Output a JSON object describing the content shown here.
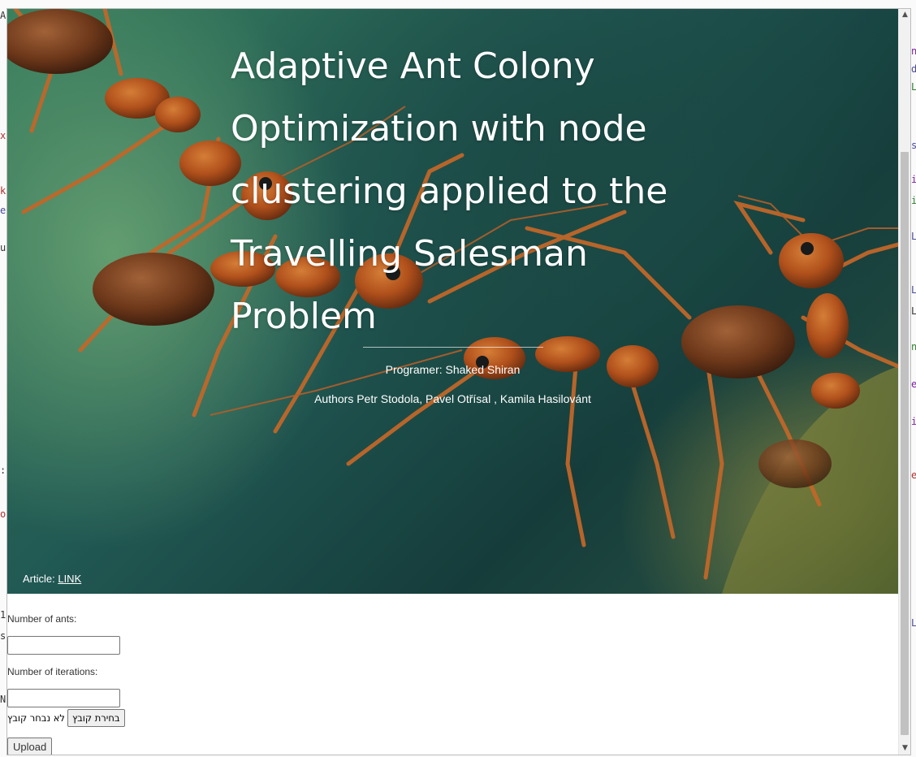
{
  "hero": {
    "title": "Adaptive Ant Colony Optimization with node clustering applied to the Travelling Salesman Problem",
    "programmer": "Programer: Shaked Shiran",
    "authors": "Authors Petr Stodola, Pavel Otřísal , Kamila Hasilovánt",
    "article_prefix": "Article: ",
    "article_link": "LINK"
  },
  "form": {
    "ants_label": "Number of ants:",
    "ants_value": "",
    "iterations_label": "Number of iterations:",
    "iterations_value": "",
    "file_button": "בחירת קובץ",
    "file_status": "לא נבחר קובץ",
    "upload_button": "Upload"
  },
  "colors": {
    "hero_green": "#3d8a64",
    "hero_teal": "#163f3d",
    "ant_orange": "#d2601a",
    "text_white": "#ffffff"
  },
  "icons": {
    "scroll_up": "triangle-up",
    "scroll_down": "triangle-down"
  }
}
